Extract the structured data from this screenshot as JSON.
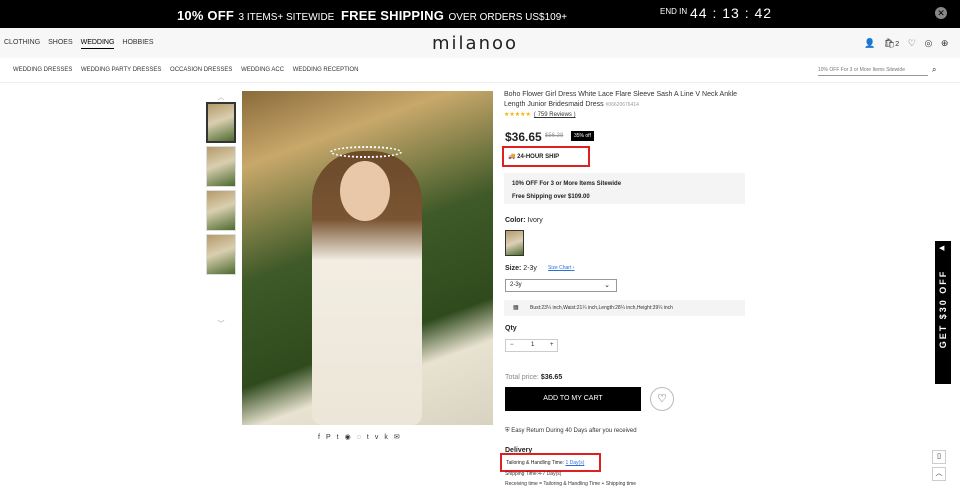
{
  "promo": {
    "p1_bold": "10% OFF",
    "p1_small": "3 ITEMS+ SITEWIDE",
    "p2_bold": "FREE SHIPPING",
    "p2_small": "OVER ORDERS US$109+",
    "end_label": "END IN",
    "clock": "44 : 13 : 42",
    "close": "✕"
  },
  "header": {
    "nav": [
      "CLOTHING",
      "SHOES",
      "WEDDING",
      "HOBBIES"
    ],
    "logo": "milanoo",
    "cart_count": "2"
  },
  "subnav": {
    "cats": [
      "WEDDING DRESSES",
      "WEDDING PARTY DRESSES",
      "OCCASION DRESSES",
      "WEDDING ACC",
      "WEDDING RECEPTION"
    ],
    "search_placeholder": "10% OFF For 3 or More Items Sitewide"
  },
  "product": {
    "title": "Boho Flower Girl Dress White Lace Flare Sleeve Sash A Line V Neck Ankle Length Junior Bridesmaid Dress",
    "sku": "#06620676414",
    "stars": "★★★★★",
    "reviews": "( 759 Reviews )",
    "price": "$36.65",
    "old_price": "$56.38",
    "discount": "35% off",
    "ship24": "24-HOUR SHIP",
    "promo1": "10% OFF For 3 or More Items Sitewide",
    "promo2": "Free Shipping over $109.00",
    "color_label": "Color:",
    "color_value": "Ivory",
    "size_label": "Size:",
    "size_value": "2-3y",
    "size_chart": "Size Chart",
    "size_select": "2-3y",
    "measure": "Bust:23¼ inch,Waist:21¼ inch,Length:28¼ inch,Height:39¼ inch",
    "qty_label": "Qty",
    "qty": "1",
    "total_label": "Total price:",
    "total": "$36.65",
    "add_cart": "ADD TO MY CART",
    "returns": "Easy Return During 40 Days after you received",
    "delivery": "Delivery",
    "tailoring": "Tailoring & Handling Time:",
    "tailoring_val": "1 Day(s)",
    "shipping_time": "Shipping Time:4-7 Day(s)",
    "receiving": "Receiving time = Tailoring & Handling Time + Shipping time"
  },
  "side": {
    "label": "GET $30 OFF"
  }
}
